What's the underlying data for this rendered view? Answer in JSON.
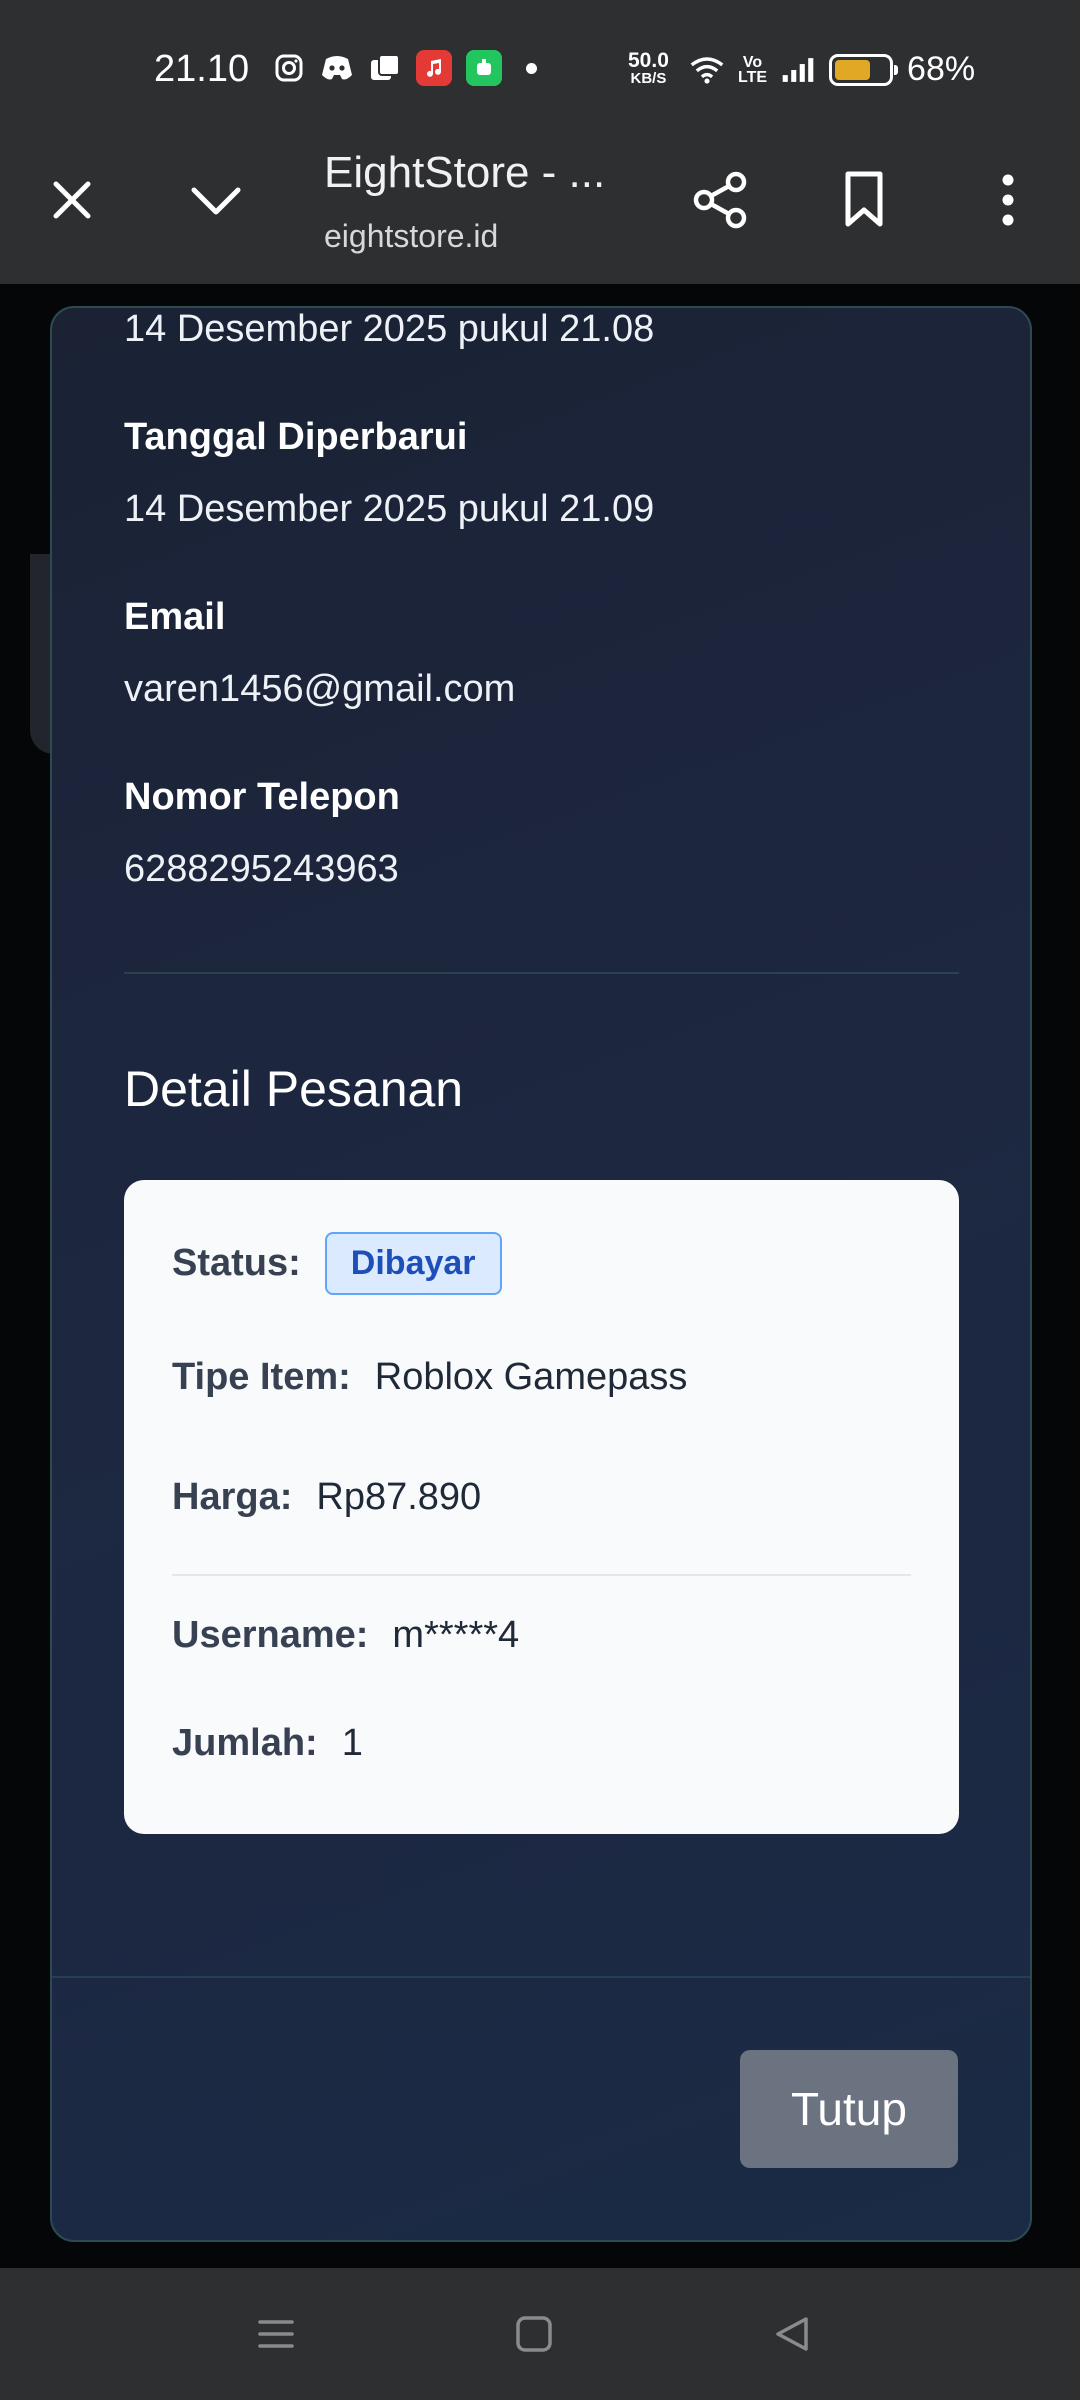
{
  "status_bar": {
    "time": "21.10",
    "net_speed_value": "50.0",
    "net_speed_unit": "KB/S",
    "volte_top": "Vo",
    "volte_bottom": "LTE",
    "battery_percent": "68%",
    "battery_level": 0.68,
    "icons": [
      "instagram-icon",
      "discord-icon",
      "gallery-icon",
      "music-app-icon",
      "game-app-icon"
    ]
  },
  "browser": {
    "tab_title": "EightStore - ...",
    "url": "eightstore.id"
  },
  "modal": {
    "created_value": "14 Desember 2025 pukul 21.08",
    "updated_label": "Tanggal Diperbarui",
    "updated_value": "14 Desember 2025 pukul 21.09",
    "email_label": "Email",
    "email_value": "varen1456@gmail.com",
    "phone_label": "Nomor Telepon",
    "phone_value": "6288295243963",
    "section_title": "Detail Pesanan",
    "order": {
      "status_label": "Status:",
      "status_value": "Dibayar",
      "item_type_label": "Tipe Item:",
      "item_type_value": "Roblox Gamepass",
      "price_label": "Harga:",
      "price_value": "Rp87.890",
      "username_label": "Username:",
      "username_value": "m*****4",
      "quantity_label": "Jumlah:",
      "quantity_value": "1"
    },
    "close_label": "Tutup"
  },
  "colors": {
    "status_badge_bg": "#dbeafe",
    "status_badge_text": "#1e4fb8",
    "close_button": "#6b7280",
    "battery": "#e0a825"
  }
}
